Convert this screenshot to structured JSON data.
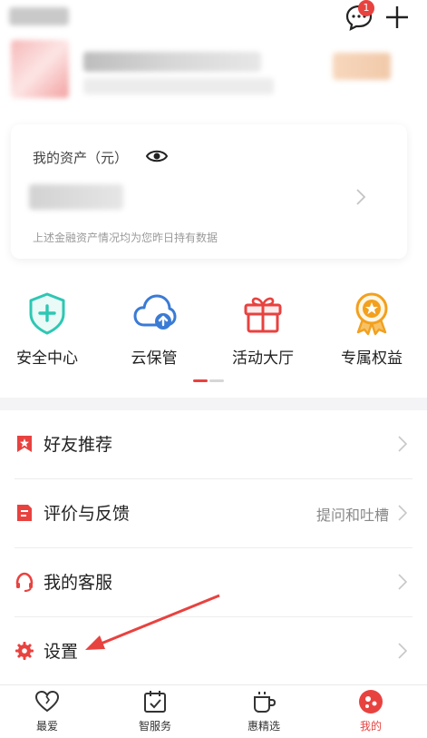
{
  "header": {
    "message_badge_count": "1",
    "icons": [
      "message-icon",
      "add-icon"
    ]
  },
  "assets": {
    "title": "我的资产（元）",
    "note": "上述金融资产情况均为您昨日持有数据"
  },
  "quick_actions": [
    {
      "label": "安全中心",
      "icon": "shield-plus-icon"
    },
    {
      "label": "云保管",
      "icon": "cloud-upload-icon"
    },
    {
      "label": "活动大厅",
      "icon": "gift-icon"
    },
    {
      "label": "专属权益",
      "icon": "medal-icon"
    }
  ],
  "menu": [
    {
      "label": "好友推荐",
      "icon": "bookmark-star-icon"
    },
    {
      "label": "评价与反馈",
      "icon": "feedback-icon",
      "extra": "提问和吐槽"
    },
    {
      "label": "我的客服",
      "icon": "headset-icon"
    },
    {
      "label": "设置",
      "icon": "gear-icon"
    }
  ],
  "tabbar": [
    {
      "label": "最爱",
      "icon": "heart-icon"
    },
    {
      "label": "智服务",
      "icon": "calendar-check-icon"
    },
    {
      "label": "惠精选",
      "icon": "cup-icon"
    },
    {
      "label": "我的",
      "icon": "profile-icon",
      "active": true
    }
  ],
  "colors": {
    "accent": "#e8423f",
    "teal": "#2ec7b3",
    "blue": "#3a7bd5",
    "gold": "#f2a01e"
  }
}
